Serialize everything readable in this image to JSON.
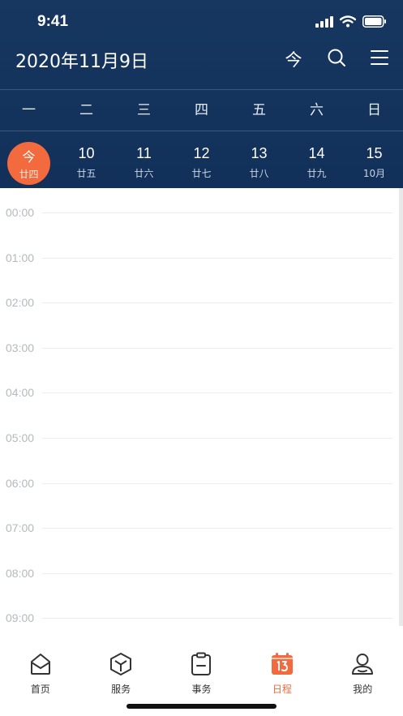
{
  "status_bar": {
    "time": "9:41"
  },
  "header": {
    "title": "2020年11月9日",
    "today_label": "今",
    "search_icon": "search-icon",
    "menu_icon": "menu-icon"
  },
  "weekdays": [
    "一",
    "二",
    "三",
    "四",
    "五",
    "六",
    "日"
  ],
  "dates": [
    {
      "day": "今",
      "lunar": "廿四",
      "selected": true
    },
    {
      "day": "10",
      "lunar": "廿五"
    },
    {
      "day": "11",
      "lunar": "廿六"
    },
    {
      "day": "12",
      "lunar": "廿七"
    },
    {
      "day": "13",
      "lunar": "廿八"
    },
    {
      "day": "14",
      "lunar": "廿九"
    },
    {
      "day": "15",
      "lunar": "10月"
    }
  ],
  "hours": [
    "00:00",
    "01:00",
    "02:00",
    "03:00",
    "04:00",
    "05:00",
    "06:00",
    "07:00",
    "08:00",
    "09:00"
  ],
  "tabbar": {
    "items": [
      {
        "label": "首页",
        "icon": "home-icon"
      },
      {
        "label": "服务",
        "icon": "cube-icon"
      },
      {
        "label": "事务",
        "icon": "clipboard-icon"
      },
      {
        "label": "日程",
        "icon": "calendar-icon",
        "active": true
      },
      {
        "label": "我的",
        "icon": "user-icon"
      }
    ]
  },
  "colors": {
    "header_bg": "#163760",
    "accent": "#f26a3d"
  }
}
